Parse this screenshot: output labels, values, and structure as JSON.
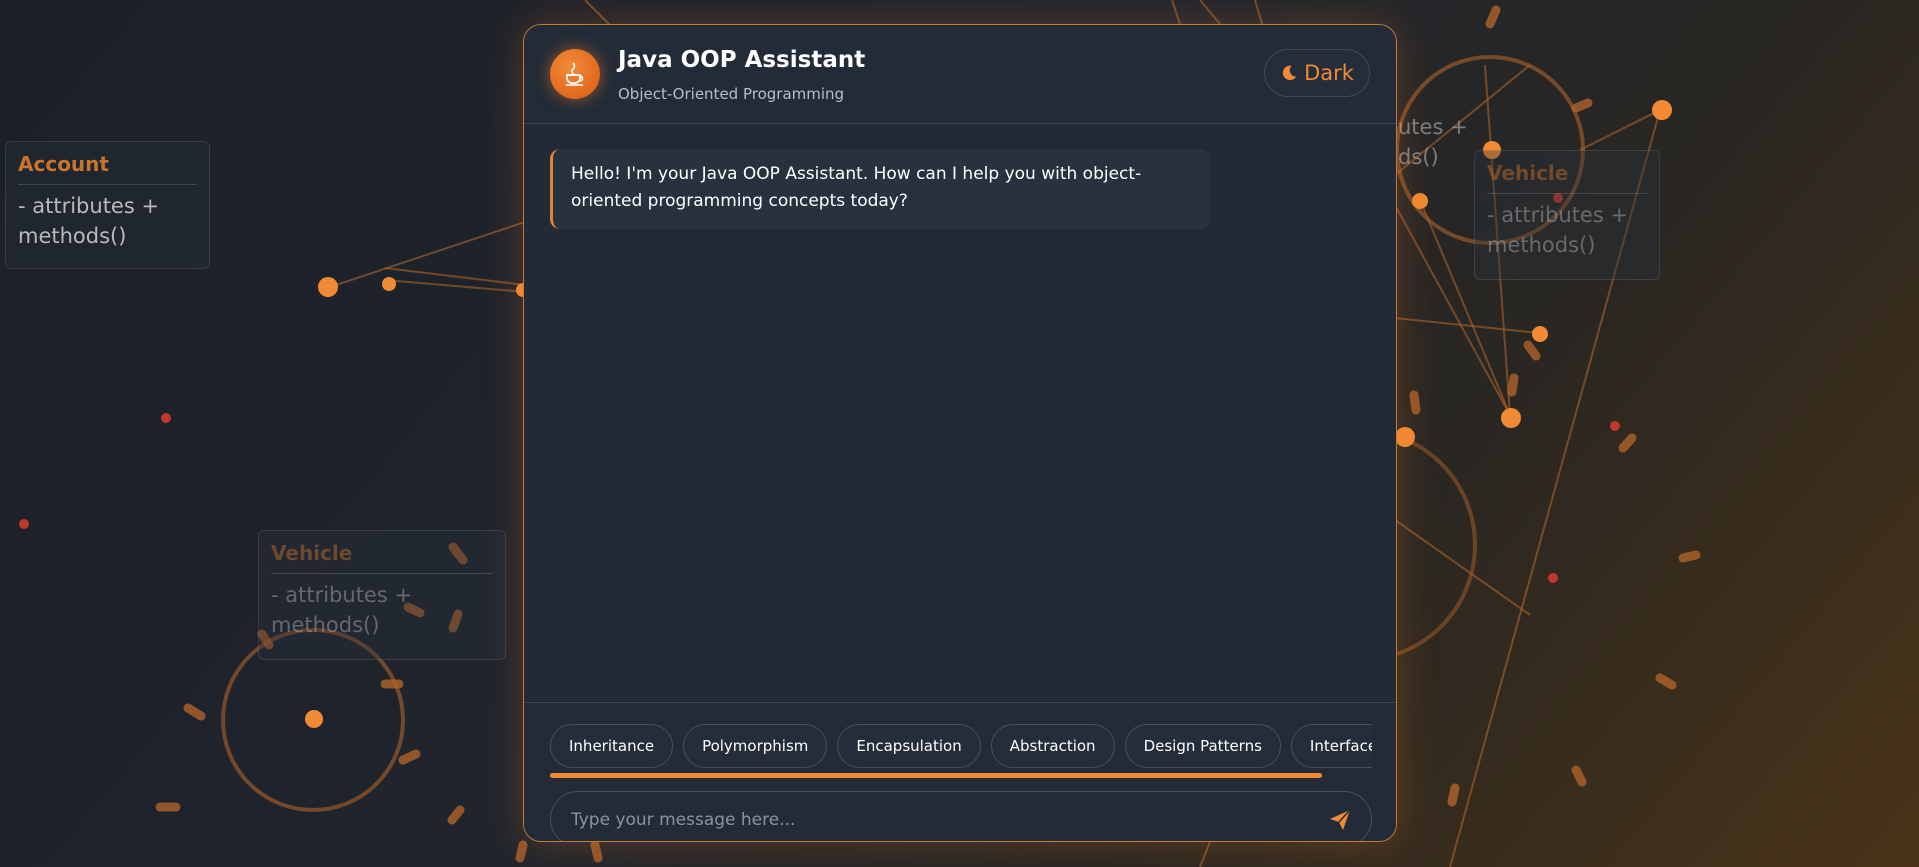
{
  "colors": {
    "accent": "#f08a34",
    "panel_bg": "#212a35",
    "page_bg": "#1c2028"
  },
  "background": {
    "uml_cards": [
      {
        "class_name": "Account",
        "members": "- attributes + methods()"
      },
      {
        "class_name": "Vehicle",
        "members": "- attributes + methods()"
      },
      {
        "class_name": "Vehicle",
        "members": "- attributes + methods()"
      }
    ],
    "partial_text": "utes +\nds()"
  },
  "header": {
    "logo_icon": "java-cup-icon",
    "title": "Java OOP Assistant",
    "subtitle": "Object-Oriented Programming",
    "theme_toggle": {
      "icon": "moon-icon",
      "label": "Dark"
    }
  },
  "messages": [
    {
      "sender": "bot",
      "text": "Hello! I'm your Java OOP Assistant. How can I help you with object-oriented programming concepts today?"
    }
  ],
  "suggestions": [
    {
      "label": "Inheritance"
    },
    {
      "label": "Polymorphism"
    },
    {
      "label": "Encapsulation"
    },
    {
      "label": "Abstraction"
    },
    {
      "label": "Design Patterns"
    },
    {
      "label": "Interfaces"
    }
  ],
  "input": {
    "placeholder": "Type your message here...",
    "value": "",
    "send_icon": "send-icon"
  }
}
